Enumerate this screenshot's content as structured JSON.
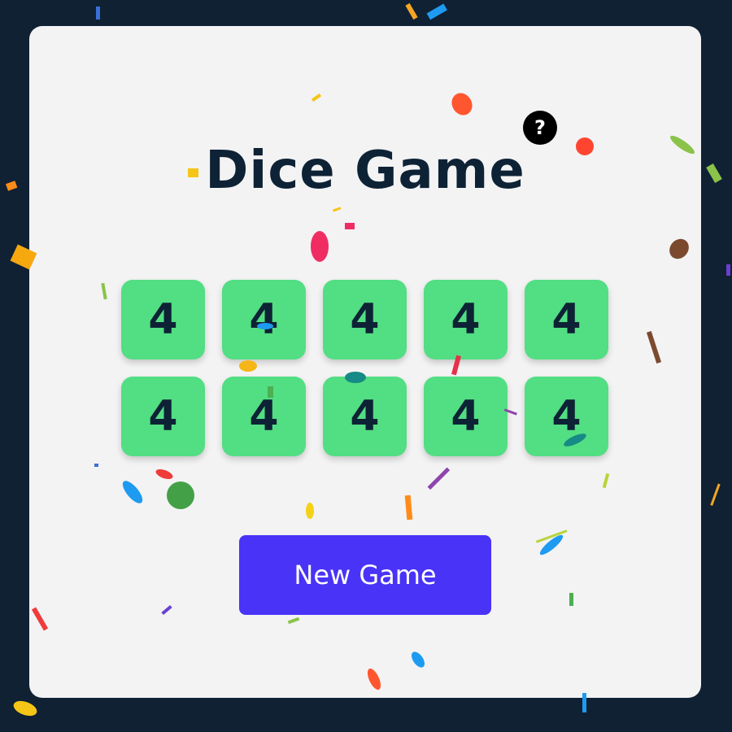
{
  "game": {
    "title": "Dice Game",
    "help_label": "?",
    "new_game_label": "New Game"
  },
  "dice": [
    {
      "value": "4"
    },
    {
      "value": "4"
    },
    {
      "value": "4"
    },
    {
      "value": "4"
    },
    {
      "value": "4"
    },
    {
      "value": "4"
    },
    {
      "value": "4"
    },
    {
      "value": "4"
    },
    {
      "value": "4"
    },
    {
      "value": "4"
    }
  ],
  "colors": {
    "background": "#102133",
    "card": "#f3f3f4",
    "die": "#52de82",
    "die_text": "#0e2235",
    "button": "#4933f7",
    "button_text": "#ffffff"
  }
}
